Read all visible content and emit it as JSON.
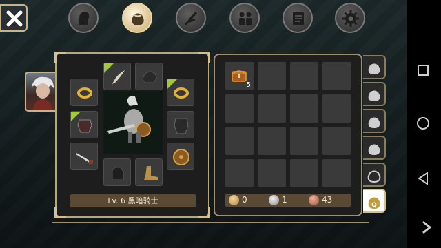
{
  "tabs": [
    {
      "name": "tab-character",
      "icon": "head-icon",
      "active": false
    },
    {
      "name": "tab-inventory",
      "icon": "bag-icon",
      "active": true
    },
    {
      "name": "tab-skills",
      "icon": "feather-icon",
      "active": false
    },
    {
      "name": "tab-party",
      "icon": "people-icon",
      "active": false
    },
    {
      "name": "tab-quests",
      "icon": "scroll-icon",
      "active": false
    },
    {
      "name": "tab-settings",
      "icon": "gear-icon",
      "active": false
    }
  ],
  "character": {
    "level_text": "Lv. 6 黑暗骑士"
  },
  "equipment": [
    {
      "slot": "ring-left",
      "icon": "ring-icon"
    },
    {
      "slot": "amulet",
      "icon": "feather-icon"
    },
    {
      "slot": "helmet",
      "icon": "gauntlet-icon"
    },
    {
      "slot": "ring-right",
      "icon": "ring-icon"
    },
    {
      "slot": "armor-left",
      "icon": "armor-icon"
    },
    {
      "slot": "armor-right",
      "icon": "armor-icon"
    },
    {
      "slot": "weapon",
      "icon": "sword-icon"
    },
    {
      "slot": "shield",
      "icon": "shield-icon"
    },
    {
      "slot": "gloves",
      "icon": "glove-icon"
    },
    {
      "slot": "boots",
      "icon": "boot-icon"
    }
  ],
  "inventory": {
    "first_item": {
      "icon": "treasure-chest-icon",
      "count": "5"
    }
  },
  "currency": {
    "gold": "0",
    "silver": "1",
    "copper": "43"
  },
  "colors": {
    "accent": "#d4c08f",
    "slot": "#3a3a3a",
    "panel": "#1e1e1e"
  }
}
